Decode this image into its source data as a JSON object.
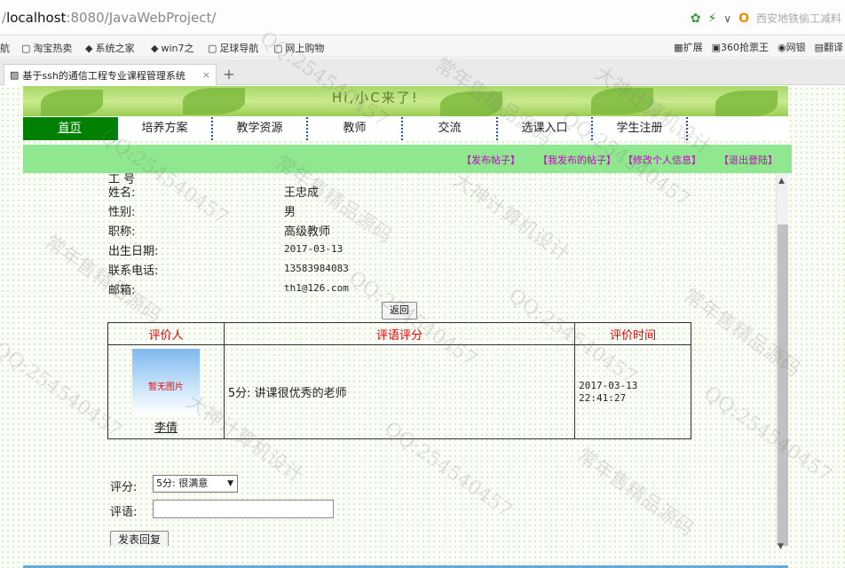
{
  "browser": {
    "url_prefix": "/",
    "url_host": "localhost",
    "url_rest": ":8080/JavaWebProject/",
    "search_hint": "西安地铁偷工减料",
    "bookmarks": [
      "航",
      "淘宝热卖",
      "系统之家",
      "win7之",
      "足球导航",
      "网上购物"
    ],
    "bookmarks_right": [
      "扩展",
      "360抢票王",
      "网银",
      "翻译"
    ],
    "tab_title": "基于ssh的通信工程专业课程管理系统",
    "tab_close": "×",
    "new_tab": "+"
  },
  "site": {
    "banner_text": "Hi,小C来了!",
    "nav": [
      "首页",
      "培养方案",
      "教学资源",
      "教师",
      "交流",
      "选课入口",
      "学生注册"
    ],
    "sublinks": [
      "【发布帖子】",
      "【我发布的帖子】",
      "【修改个人信息】",
      "【退出登陆】"
    ]
  },
  "teacher": {
    "partial_label": "工 号",
    "rows": [
      {
        "label": "姓名:",
        "value": "王忠成"
      },
      {
        "label": "性别:",
        "value": "男"
      },
      {
        "label": "职称:",
        "value": "高级教师"
      },
      {
        "label": "出生日期:",
        "value": "2017-03-13"
      },
      {
        "label": "联系电话:",
        "value": "13583984083"
      },
      {
        "label": "邮箱:",
        "value": "th1@126.com"
      }
    ],
    "back_label": "返回"
  },
  "reviews": {
    "headers": [
      "评价人",
      "评语评分",
      "评价时间"
    ],
    "rows": [
      {
        "avatar_text": "暂无图片",
        "name": "李倩",
        "comment": "5分: 讲课很优秀的老师",
        "time_date": "2017-03-13",
        "time_clock": "22:41:27"
      }
    ]
  },
  "form": {
    "score_label": "评分:",
    "score_selected": "5分: 很满意",
    "comment_label": "评语:",
    "comment_value": "",
    "submit_label": "发表回复"
  },
  "watermarks": [
    "QQ:254540457",
    "大神计算机设计",
    "常年售精品源码"
  ],
  "colors": {
    "nav_active": "#008000",
    "subbar": "#8fe88f",
    "sublink": "#c800c8",
    "header_text": "#e00000"
  }
}
